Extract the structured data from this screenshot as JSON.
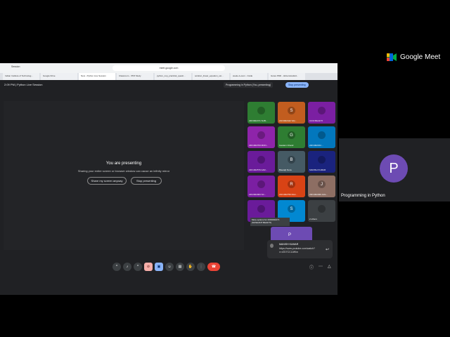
{
  "brand": {
    "name": "Google Meet"
  },
  "self_tile": {
    "initial": "P",
    "name": "Programming in Python"
  },
  "browser": {
    "profile": "Session",
    "url": "meet.google.com",
    "tabs": [
      "Indian Institute of Technolog...",
      "Google Drive",
      "New - Python Live Session",
      "Classroom - IITM Study",
      "python_cop_practical_questi...",
      "solution_linear_equation_usi...",
      "week+1+sum - Cside",
      "Gutes PDD - Hinterviewfeld..."
    ]
  },
  "meeting": {
    "time": "2:09 PM",
    "title": "Python Live Session",
    "presenting_chip": "Programming in Python (You, presenting)",
    "stop_label": "Stop presenting"
  },
  "overlay": {
    "title": "You are presenting",
    "subtitle": "Sharing your entire screen or browser window can cause an infinity mirror",
    "share_this_tab": "Share my screen anyway",
    "stop": "Stop presenting"
  },
  "participants": [
    {
      "initial": "",
      "name": "23F3002471 SUB...",
      "color": "#2e7d32"
    },
    {
      "initial": "S",
      "name": "21F3002442 SAI...",
      "color": "#c25d1f"
    },
    {
      "initial": "",
      "name": "CCNI BHAKTI",
      "color": "#7b1fa2"
    },
    {
      "initial": "",
      "name": "23F1002763 MON...",
      "color": "#8e24aa"
    },
    {
      "initial": "G",
      "name": "Gautam Chand",
      "color": "#2e7d32"
    },
    {
      "initial": "",
      "name": "22F1002154 ...",
      "color": "#0277bd"
    },
    {
      "initial": "",
      "name": "22F1002579 AAR...",
      "color": "#6a1b9a"
    },
    {
      "initial": "B",
      "name": "Biswajit Nura",
      "color": "#455a64"
    },
    {
      "initial": "",
      "name": "MANISH KUMAR",
      "color": "#1a237e"
    },
    {
      "initial": "",
      "name": "22F2002963 SC...",
      "color": "#7b1fa2"
    },
    {
      "initial": "R",
      "name": "21F1002750 RAJ...",
      "color": "#d84315"
    },
    {
      "initial": "J",
      "name": "23F1002299 JAG...",
      "color": "#8d6e63"
    },
    {
      "initial": "",
      "name": "",
      "color": "#6a1b9a"
    },
    {
      "initial": "S",
      "name": "",
      "color": "#0288d1"
    },
    {
      "initial": "",
      "name": "2 others",
      "color": "#3c4043"
    }
  ],
  "tooltip": "More options for 23F3002471 (SUSHANT BHAKTI)",
  "self_mini": {
    "initial": "P"
  },
  "toast": {
    "name": "MANISH KUMAR",
    "message": "https://www.youtube.com/watch?v=rZD7CC1AfKw"
  }
}
